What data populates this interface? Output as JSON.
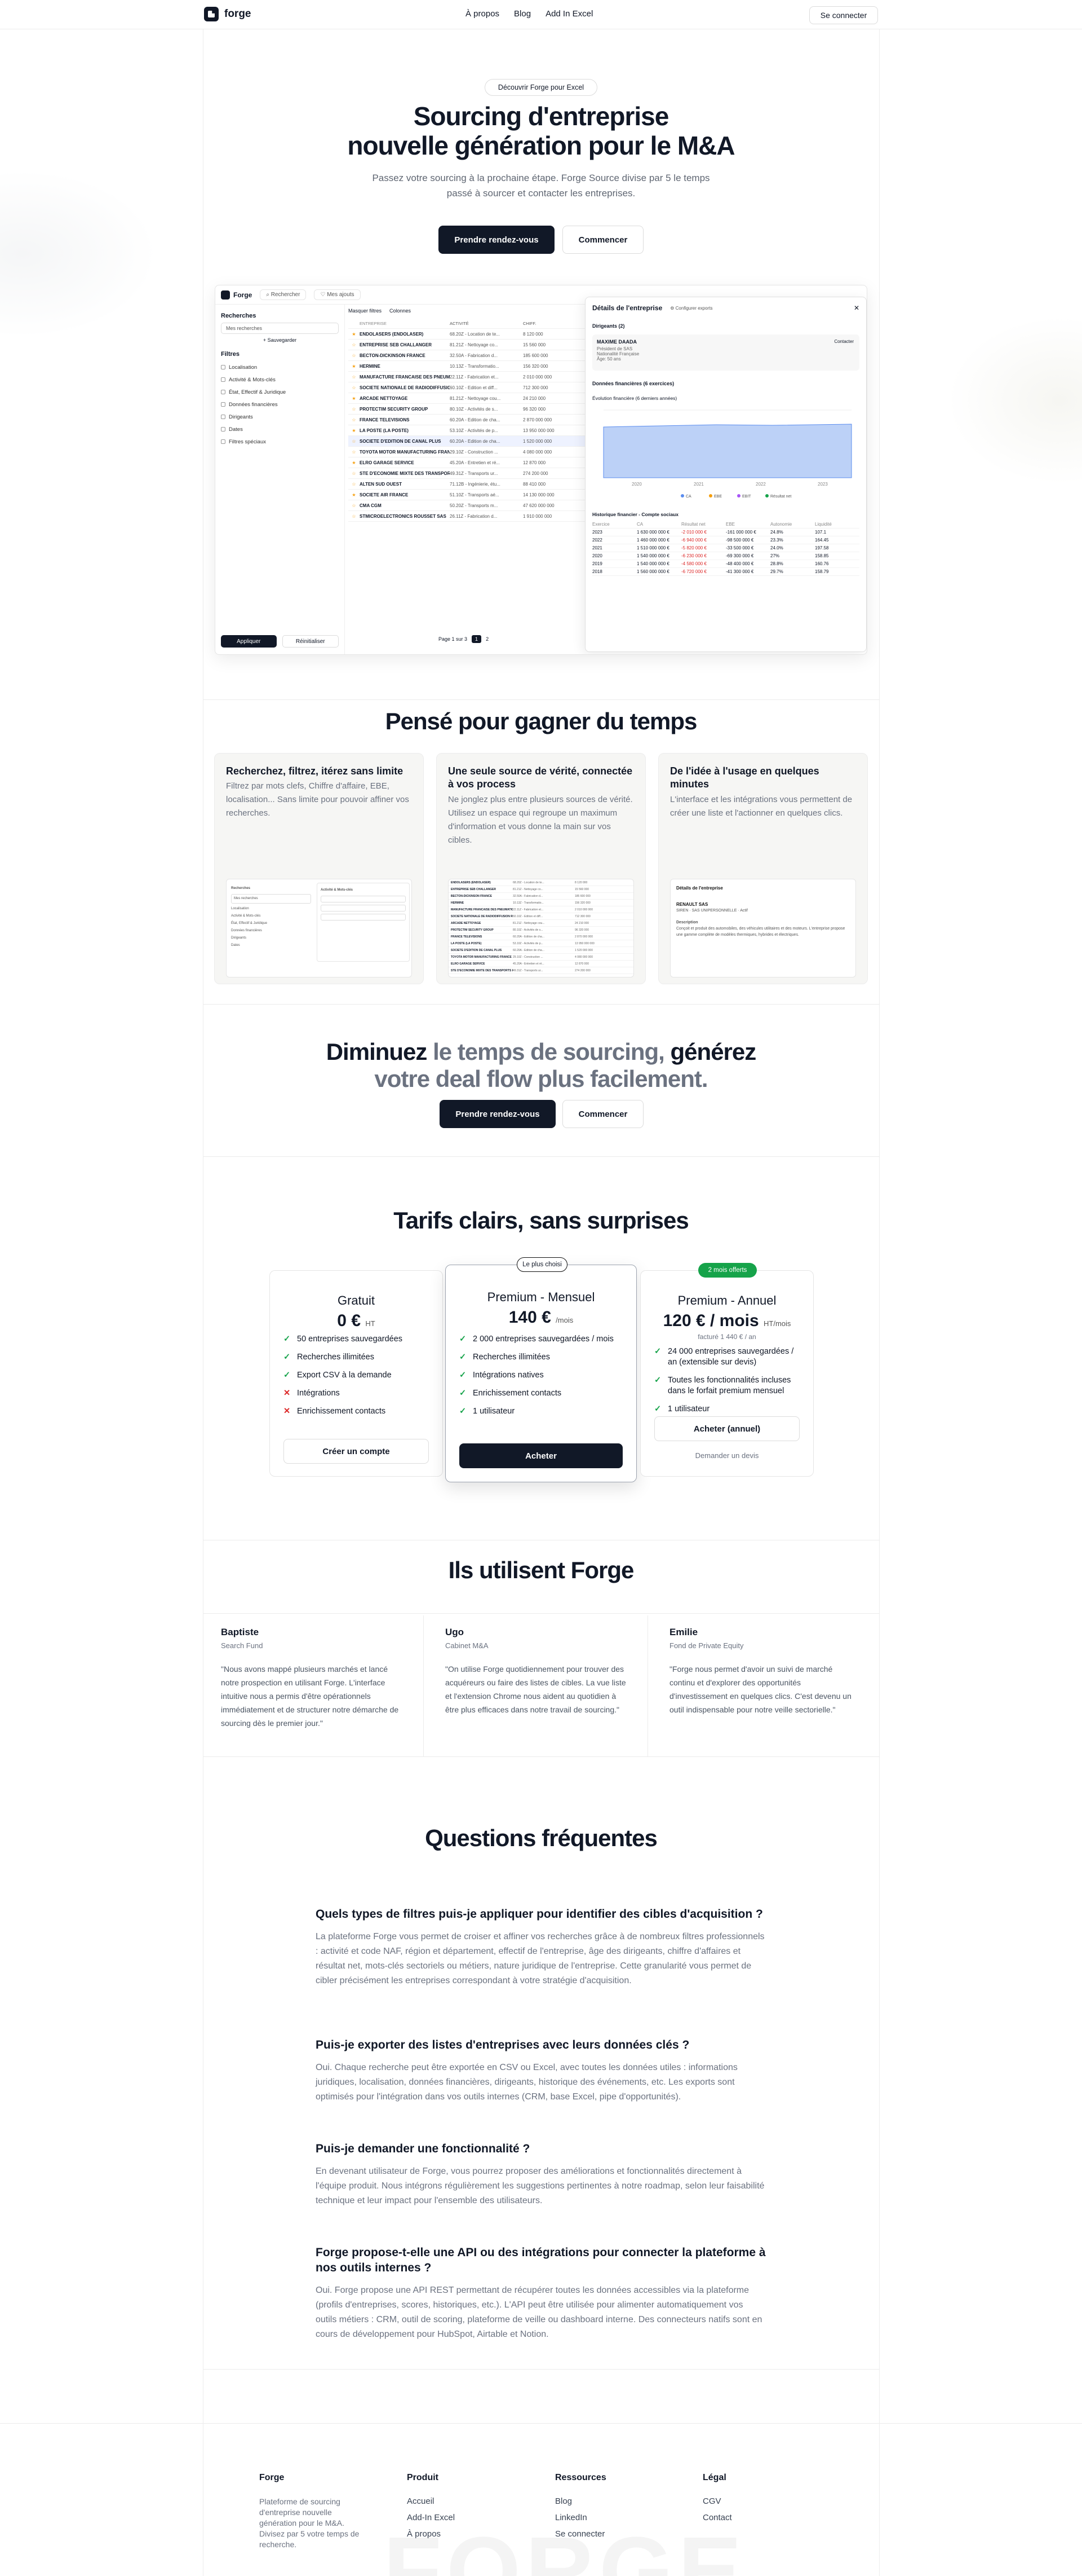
{
  "nav": {
    "logo": "forge",
    "links": [
      "À propos",
      "Blog",
      "Add In Excel"
    ],
    "signin": "Se connecter"
  },
  "hero": {
    "badge": "Découvrir Forge pour Excel",
    "title_l1": "Sourcing d'entreprise",
    "title_l2": "nouvelle génération pour le M&A",
    "sub": "Passez votre sourcing à la prochaine étape. Forge Source divise par 5 le temps passé à sourcer et contacter les entreprises.",
    "cta_primary": "Prendre rendez-vous",
    "cta_secondary": "Commencer"
  },
  "app": {
    "logo": "Forge",
    "search": "Rechercher",
    "tips": "Mes ajouts",
    "side": {
      "title": "Recherches",
      "saved": "Mes recherches",
      "save_btn": "+ Sauvegarder",
      "filters_title": "Filtres",
      "filters": [
        "Localisation",
        "Activité & Mots-clés",
        "État, Effectif & Juridique",
        "Données financières",
        "Dirigeants",
        "Dates",
        "Filtres spéciaux"
      ],
      "apply": "Appliquer",
      "reset": "Réinitialiser"
    },
    "toolbar": [
      "Masquer filtres",
      "Colonnes"
    ],
    "cols": [
      "ENTREPRISE",
      "ACTIVITÉ",
      "CHIFF."
    ],
    "rows": [
      [
        "ENDOLASERS (ENDOLASER)",
        "68.20Z - Location de te...",
        "8 120 000"
      ],
      [
        "ENTREPRISE SEB CHALLANGER",
        "81.21Z - Nettoyage co...",
        "15 560 000"
      ],
      [
        "BECTON-DICKINSON FRANCE",
        "32.50A - Fabrication d...",
        "185 600 000"
      ],
      [
        "HERMINE",
        "10.13Z - Transformatio...",
        "156 320 000"
      ],
      [
        "MANUFACTURE FRANCAISE DES PNEUMATIQUES",
        "22.11Z - Fabrication et...",
        "2 010 000 000"
      ],
      [
        "SOCIETE NATIONALE DE RADIODIFFUSION RADIO FRANCE",
        "60.10Z - Edition et diff...",
        "712 300 000"
      ],
      [
        "ARCADE NETTOYAGE",
        "81.21Z - Nettoyage cou...",
        "24 210 000"
      ],
      [
        "PROTECTIM SECURITY GROUP",
        "80.10Z - Activités de s...",
        "96 320 000"
      ],
      [
        "FRANCE TELEVISIONS",
        "60.20A - Edition de cha...",
        "2 870 000 000"
      ],
      [
        "LA POSTE (LA POSTE)",
        "53.10Z - Activités de p...",
        "13 950 000 000"
      ],
      [
        "SOCIETE D'EDITION DE CANAL PLUS",
        "60.20A - Edition de cha...",
        "1 520 000 000"
      ],
      [
        "TOYOTA MOTOR MANUFACTURING FRANCE",
        "29.10Z - Construction ...",
        "4 080 000 000"
      ],
      [
        "ELRO GARAGE SERVICE",
        "45.20A - Entretien et ré...",
        "12 870 000"
      ],
      [
        "STE D'ECONOMIE MIXTE DES TRANSPORTS EN COMMUN",
        "49.31Z - Transports ur...",
        "274 200 000"
      ],
      [
        "ALTEN SUD OUEST",
        "71.12B - Ingénierie, étu...",
        "88 410 000"
      ],
      [
        "SOCIETE AIR FRANCE",
        "51.10Z - Transports aé...",
        "14 130 000 000"
      ],
      [
        "CMA CGM",
        "50.20Z - Transports m...",
        "47 620 000 000"
      ],
      [
        "STMICROELECTRONICS ROUSSET SAS",
        "26.11Z - Fabrication d...",
        "1 910 000 000"
      ]
    ],
    "pager": {
      "label": "Page 1 sur 3",
      "pages": [
        "1",
        "2"
      ]
    },
    "panel": {
      "title": "Détails de l'entreprise",
      "export": "Configurer exports",
      "section": "Dirigeants (2)",
      "person": "MAXIME DAADA",
      "role": "Président de SAS",
      "nat": "Nationalité Française",
      "age": "Âge: 50 ans",
      "contact": "Contacter",
      "fin_title": "Données financières (6 exercices)",
      "chart_title": "Évolution financière (6 derniers années)",
      "years": [
        "2020",
        "2021",
        "2022",
        "2023"
      ],
      "legend": [
        "CA",
        "EBE",
        "EBIT",
        "Résultat net"
      ],
      "hist_title": "Historique financier - Compte sociaux",
      "hist_cols": [
        "Exercice",
        "CA",
        "Résultat net",
        "EBE",
        "Autonomie",
        "Liquidité"
      ],
      "hist": [
        [
          "2023",
          "1 630 000 000 €",
          "-2 010 000 €",
          "-161 000 000 €",
          "24.8%",
          "107.1"
        ],
        [
          "2022",
          "1 460 000 000 €",
          "-6 940 000 €",
          "-98 500 000 €",
          "23.3%",
          "164.45"
        ],
        [
          "2021",
          "1 510 000 000 €",
          "-5 820 000 €",
          "-33 500 000 €",
          "24.0%",
          "197.58"
        ],
        [
          "2020",
          "1 540 000 000 €",
          "-6 230 000 €",
          "-69 300 000 €",
          "27%",
          "158.85"
        ],
        [
          "2019",
          "1 540 000 000 €",
          "-4 580 000 €",
          "-48 400 000 €",
          "28.8%",
          "160.76"
        ],
        [
          "2018",
          "1 560 000 000 €",
          "-6 720 000 €",
          "-41 300 000 €",
          "29.7%",
          "158.79"
        ]
      ]
    }
  },
  "features": {
    "title": "Pensé pour gagner du temps",
    "cards": [
      {
        "title": "Recherchez, filtrez, itérez sans limite",
        "text": "Filtrez par mots clefs, Chiffre d'affaire, EBE, localisation... Sans limite pour pouvoir affiner vos recherches."
      },
      {
        "title": "Une seule source de vérité, connectée à vos process",
        "text": "Ne jonglez plus entre plusieurs sources de vérité. Utilisez un espace qui regroupe un maximum d'information et vous donne la main sur vos cibles."
      },
      {
        "title": "De l'idée à l'usage en quelques minutes",
        "text": "L'interface et les intégrations vous permettent de créer une liste et l'actionner en quelques clics."
      }
    ],
    "shot3": {
      "title": "Détails de l'entreprise",
      "name": "RENAULT SAS",
      "meta": "SIREN · SAS UNIPERSONNELLE · Actif",
      "desc": "Description",
      "desc_text": "Conçoit et produit des automobiles, des véhicules utilitaires et des moteurs. L'entreprise propose une gamme complète de modèles thermiques, hybrides et électriques."
    }
  },
  "cta": {
    "p1": "Diminuez ",
    "p2": "le temps de sourcing,",
    "p3": " générez",
    "p4": "votre deal flow plus facilement.",
    "primary": "Prendre rendez-vous",
    "secondary": "Commencer"
  },
  "pricing": {
    "title": "Tarifs clairs, sans surprises",
    "plans": [
      {
        "name": "Gratuit",
        "price": "0 €",
        "unit": "HT",
        "features": [
          [
            "ok",
            "50 entreprises sauvegardées"
          ],
          [
            "ok",
            "Recherches illimitées"
          ],
          [
            "ok",
            "Export CSV à la demande"
          ],
          [
            "no",
            "Intégrations"
          ],
          [
            "no",
            "Enrichissement contacts"
          ]
        ],
        "cta": "Créer un compte"
      },
      {
        "badge": "Le plus choisi",
        "name": "Premium - Mensuel",
        "price": "140 €",
        "unit": "/mois",
        "features": [
          [
            "ok",
            "2 000 entreprises sauvegardées / mois"
          ],
          [
            "ok",
            "Recherches illimitées"
          ],
          [
            "ok",
            "Intégrations natives"
          ],
          [
            "ok",
            "Enrichissement contacts"
          ],
          [
            "ok",
            "1 utilisateur"
          ]
        ],
        "cta": "Acheter"
      },
      {
        "badge": "2 mois offerts",
        "name": "Premium - Annuel",
        "price": "120 € / mois",
        "unit": "HT/mois",
        "note": "facturé 1 440 € / an",
        "features": [
          [
            "ok",
            "24 000 entreprises sauvegardées / an (extensible sur devis)"
          ],
          [
            "ok",
            "Toutes les fonctionnalités incluses dans le forfait premium mensuel"
          ],
          [
            "ok",
            "1 utilisateur"
          ]
        ],
        "cta": "Acheter (annuel)",
        "link": "Demander un devis"
      }
    ]
  },
  "testimonials": {
    "title": "Ils utilisent Forge",
    "items": [
      {
        "name": "Baptiste",
        "company": "Search Fund",
        "quote": "\"Nous avons mappé plusieurs marchés et lancé notre prospection en utilisant Forge. L'interface intuitive nous a permis d'être opérationnels immédiatement et de structurer notre démarche de sourcing dès le premier jour.\""
      },
      {
        "name": "Ugo",
        "company": "Cabinet M&A",
        "quote": "\"On utilise Forge quotidiennement pour trouver des acquéreurs ou faire des listes de cibles. La vue liste et l'extension Chrome nous aident au quotidien à être plus efficaces dans notre travail de sourcing.\""
      },
      {
        "name": "Emilie",
        "company": "Fond de Private Equity",
        "quote": "\"Forge nous permet d'avoir un suivi de marché continu et d'explorer des opportunités d'investissement en quelques clics. C'est devenu un outil indispensable pour notre veille sectorielle.\""
      }
    ]
  },
  "faq": {
    "title": "Questions fréquentes",
    "items": [
      {
        "q": "Quels types de filtres puis-je appliquer pour identifier des cibles d'acquisition ?",
        "a": "La plateforme Forge vous permet de croiser et affiner vos recherches grâce à de nombreux filtres professionnels : activité et code NAF, région et département, effectif de l'entreprise, âge des dirigeants, chiffre d'affaires et résultat net, mots-clés sectoriels ou métiers, nature juridique de l'entreprise. Cette granularité vous permet de cibler précisément les entreprises correspondant à votre stratégie d'acquisition."
      },
      {
        "q": "Puis-je exporter des listes d'entreprises avec leurs données clés ?",
        "a": "Oui. Chaque recherche peut être exportée en CSV ou Excel, avec toutes les données utiles : informations juridiques, localisation, données financières, dirigeants, historique des événements, etc. Les exports sont optimisés pour l'intégration dans vos outils internes (CRM, base Excel, pipe d'opportunités)."
      },
      {
        "q": "Puis-je demander une fonctionnalité ?",
        "a": "En devenant utilisateur de Forge, vous pourrez proposer des améliorations et fonctionnalités directement à l'équipe produit. Nous intégrons régulièrement les suggestions pertinentes à notre roadmap, selon leur faisabilité technique et leur impact pour l'ensemble des utilisateurs."
      },
      {
        "q": "Forge propose-t-elle une API ou des intégrations pour connecter la plateforme à nos outils internes ?",
        "a": "Oui. Forge propose une API REST permettant de récupérer toutes les données accessibles via la plateforme (profils d'entreprises, scores, historiques, etc.). L'API peut être utilisée pour alimenter automatiquement vos outils métiers : CRM, outil de scoring, plateforme de veille ou dashboard interne. Des connecteurs natifs sont en cours de développement pour HubSpot, Airtable et Notion."
      }
    ]
  },
  "footer": {
    "brand": "Forge",
    "tagline": "Plateforme de sourcing d'entreprise nouvelle génération pour le M&A. Divisez par 5 votre temps de recherche.",
    "cols": [
      {
        "title": "Produit",
        "links": [
          "Accueil",
          "Add-In Excel",
          "À propos"
        ]
      },
      {
        "title": "Ressources",
        "links": [
          "Blog",
          "LinkedIn",
          "Se connecter"
        ]
      },
      {
        "title": "Légal",
        "links": [
          "CGV",
          "Contact"
        ]
      }
    ],
    "watermark": "FORGE"
  },
  "colors": {
    "dark": "#111827",
    "muted": "#6b7280",
    "check": "#16a34a",
    "cross": "#dc2626",
    "badge_green": "#16a34a",
    "chart_blue": "#5b8def"
  }
}
